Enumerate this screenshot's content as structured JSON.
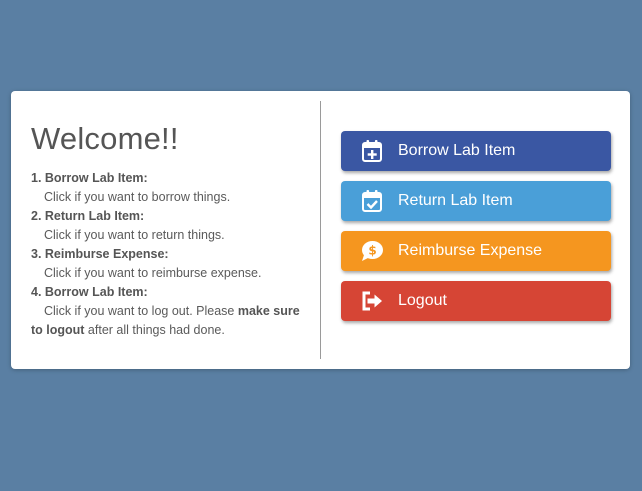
{
  "welcome": {
    "title": "Welcome!!",
    "instructions": [
      {
        "title": "1. Borrow Lab Item:",
        "desc": "Click if you want to borrow things."
      },
      {
        "title": "2. Return Lab Item:",
        "desc": "Click if you want to return things."
      },
      {
        "title": "3. Reimburse Expense:",
        "desc": "Click if you want to reimburse expense."
      },
      {
        "title": "4. Borrow Lab Item:",
        "desc_pre": "Click if you want to log out. Please ",
        "desc_bold": "make sure to logout",
        "desc_post": " after all things had done."
      }
    ]
  },
  "buttons": {
    "borrow": {
      "label": "Borrow Lab Item",
      "icon": "calendar-plus-icon",
      "color": "#3a57a3"
    },
    "return": {
      "label": "Return Lab Item",
      "icon": "calendar-check-icon",
      "color": "#4a9fd8"
    },
    "reimburse": {
      "label": "Reimburse Expense",
      "icon": "money-bubble-icon",
      "color": "#f5961f"
    },
    "logout": {
      "label": "Logout",
      "icon": "sign-out-icon",
      "color": "#d64535"
    }
  },
  "colors": {
    "background": "#5a7fa3",
    "card": "#ffffff",
    "text": "#555555"
  }
}
